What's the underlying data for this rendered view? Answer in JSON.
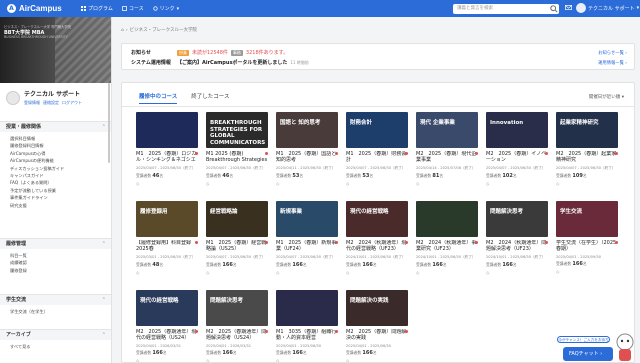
{
  "topbar": {
    "logo_text": "AirCampus",
    "nav": [
      {
        "label": "プログラム",
        "icon": "grid-icon"
      },
      {
        "label": "コース",
        "icon": "book-icon"
      },
      {
        "label": "リンク",
        "icon": "link-icon"
      }
    ],
    "search_placeholder": "講義と発言を検索",
    "user_name": "テクニカル サポート"
  },
  "sidebar": {
    "banner_line1": "ビジネス・ブレークスルー大学 専門職大学院",
    "banner_line2": "BBT大学院 MBA",
    "banner_line3": "BUSINESS BREAKTHROUGH UNIVERSITY",
    "profile_name": "テクニカル サポート",
    "profile_links": [
      "登録情報",
      "連絡設定",
      "ログアウト"
    ],
    "sections": [
      {
        "title": "授業・履修関係",
        "items": [
          "選択科目情報",
          "履修登録科目情報",
          "AirCampusの心得",
          "AirCampusの便利機能",
          "ディスカッション投稿ガイド",
          "キャンパスガイド",
          "FAQ（よくある質問）",
          "予定が流動している授業",
          "事件集ガイドライン",
          "研究支援"
        ]
      },
      {
        "title": "履修管理",
        "items": [
          "科目一覧",
          "成績確認",
          "履修登録"
        ]
      },
      {
        "title": "学生交流",
        "items": [
          "学生交流（在学生）"
        ]
      },
      {
        "title": "アーカイブ",
        "items": [
          "すべて見る"
        ]
      }
    ]
  },
  "breadcrumb": [
    "ビジネス・ブレークスルー大学院"
  ],
  "notice": {
    "label1": "お知らせ",
    "tag1": "授業",
    "unread_text": "未読が12548件",
    "tag2": "事務",
    "count_text": "3218件あります。",
    "more1": "お知らせ一覧 ›",
    "label2": "システム運用情報",
    "message": "【ご案内】AirCampusポータルを更新しました",
    "ago": "11 時間前",
    "more2": "運用情報一覧 ›"
  },
  "tabs": [
    "履修中のコース",
    "終了したコース"
  ],
  "sort_label": "開催日が近い順 ▾",
  "courses": [
    {
      "title": "M1　2025（春期）ロジカル・シンキング＆ネゴシエーション",
      "date": "2025/04/07 - 2025/06/30（終了）",
      "count": "46",
      "tt": "",
      "bg": "#1e2a5a"
    },
    {
      "title": "M1 2025 (春期) Breakthrough Strategies for Global Communicators",
      "date": "2025/04/07 - 2025/06/30（終了）",
      "count": "46",
      "tt": "BREAKTHROUGH STRATEGIES FOR GLOBAL COMMUNICATORS",
      "bg": "#2b2b2b"
    },
    {
      "title": "M1　2025（春期）国語と知的思考",
      "date": "2025/04/11 - 2025/06/30（終了）",
      "count": "53",
      "tt": "国語と 知的思考",
      "bg": "#4a3b3b"
    },
    {
      "title": "M1　2025（春期）財務会計",
      "date": "2025/04/07 - 2025/06/30（終了）",
      "count": "53",
      "tt": "財務会計",
      "bg": "#1d3d6b"
    },
    {
      "title": "M2　2025（春期）現代企業事業",
      "date": "2025/04/14 - 2025/07/08（終了）",
      "count": "81",
      "tt": "現代 企業事業",
      "bg": "#3a4a6a"
    },
    {
      "title": "M2　2025（春期）イノベーション",
      "date": "2025/04/07 - 2025/06/30（終了）",
      "count": "102",
      "tt": "Innovation",
      "bg": "#2a2d4a"
    },
    {
      "title": "M2　2025（春期）起業家精神研究",
      "date": "2025/04/07 - 2025/06/30（終了）",
      "count": "109",
      "tt": "起業家精神研究",
      "bg": "#23304a"
    },
    {
      "title": "【履修登録用】科目登録 2025春",
      "date": "2025/03/01 - 2025/06/30（終了）",
      "count": "48",
      "tt": "履修登録用",
      "bg": "#5a4a2a"
    },
    {
      "title": "M1　2025（春期）経営戦略論（US25）",
      "date": "2025/04/07 - 2025/06/30（終了）",
      "count": "166",
      "tt": "経営戦略論",
      "bg": "#3a3020"
    },
    {
      "title": "M1　2025（春期）新規事業（UF24）",
      "date": "2025/04/07 - 2025/06/30（終了）",
      "count": "166",
      "tt": "新規事業",
      "bg": "#2a4a6a"
    },
    {
      "title": "M2　2024（秋期通年）現代の経営戦略（UF23）",
      "date": "2024/10/01 - 2025/06/30（終了）",
      "count": "166",
      "tt": "現代の経営戦略",
      "bg": "#4a2a2a"
    },
    {
      "title": "M2　2024（秋期通年）事業研究（UF23）",
      "date": "2024/10/01 - 2025/06/30（終了）",
      "count": "166",
      "tt": "",
      "bg": "#2a3a2a"
    },
    {
      "title": "M2　2024（秋期通年）問題解決思考（UF23）",
      "date": "2024/10/01 - 2025/06/30（終了）",
      "count": "166",
      "tt": "問題解決思考",
      "bg": "#3a3a3a"
    },
    {
      "title": "学生交流（在学生）（2025春期）",
      "date": "2025/04/01 - 2025/09/30",
      "count": "166",
      "tt": "学生交流",
      "bg": "#6a2a3a"
    },
    {
      "title": "M2　2025（春期通年）現代の経営戦略（US24）",
      "date": "2025/04/01 - 2026/03/31",
      "count": "166",
      "tt": "現代の経営戦略",
      "bg": "#2a3a5a"
    },
    {
      "title": "M2　2025（春期通年）問題解決思考（US24）",
      "date": "2025/04/01 - 2026/03/31",
      "count": "166",
      "tt": "問題解決思考",
      "bg": "#4a4a4a"
    },
    {
      "title": "M1　3035（春期）組織行動・人的資本経営",
      "date": "2025/04/01 - 2025/06/30",
      "count": "166",
      "tt": "",
      "bg": "#2a2a4a"
    },
    {
      "title": "M2　2025（春期）問題解決の実践",
      "date": "2025/04/01 - 2025/06/30",
      "count": "166",
      "tt": "問題解決の実践",
      "bg": "#3a2a2a"
    }
  ],
  "card_count_label": "受講者数",
  "card_count_unit": "名",
  "float_button": "今がチャンス！ご入力をお待ち",
  "faq_label": "FAQチャット"
}
